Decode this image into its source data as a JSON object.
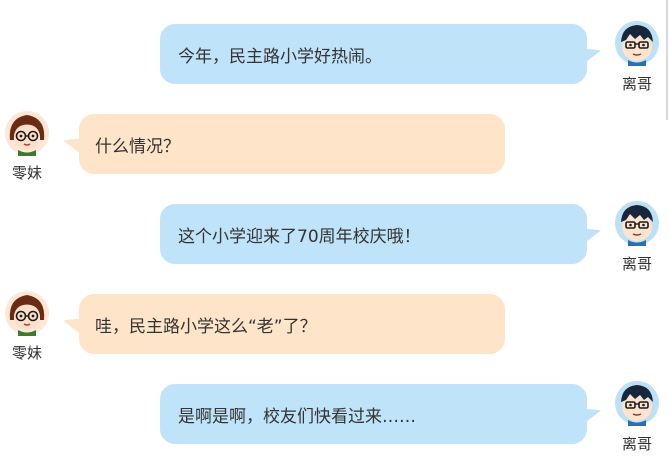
{
  "messages": [
    {
      "side": "right",
      "sender": "离哥",
      "text": "今年，民主路小学好热闹。"
    },
    {
      "side": "left",
      "sender": "零妹",
      "text": "什么情况？"
    },
    {
      "side": "right",
      "sender": "离哥",
      "text": "这个小学迎来了70周年校庆哦！"
    },
    {
      "side": "left",
      "sender": "零妹",
      "text": "哇，民主路小学这么“老”了？"
    },
    {
      "side": "right",
      "sender": "离哥",
      "text": "是啊是啊，校友们快看过来……"
    }
  ],
  "colors": {
    "right_bubble": "#bfe3f8",
    "left_bubble": "#fee4c8",
    "text": "#333333"
  },
  "icons": {
    "boy_avatar": "boy-avatar-icon",
    "girl_avatar": "girl-avatar-icon"
  }
}
